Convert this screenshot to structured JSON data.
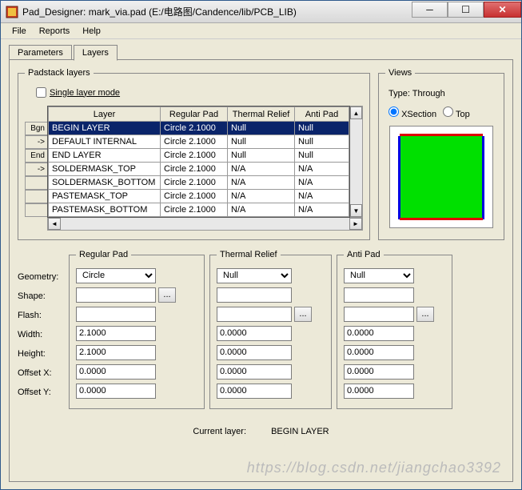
{
  "titlebar": {
    "title": "Pad_Designer: mark_via.pad (E:/电路图/Candence/lib/PCB_LIB)"
  },
  "menu": {
    "file": "File",
    "reports": "Reports",
    "help": "Help"
  },
  "tabs": {
    "parameters": "Parameters",
    "layers": "Layers"
  },
  "padstack": {
    "legend": "Padstack layers",
    "single_layer": "Single layer mode",
    "headers": {
      "layer": "Layer",
      "regular": "Regular Pad",
      "thermal": "Thermal Relief",
      "anti": "Anti Pad"
    },
    "rowlabels": [
      "Bgn",
      "->",
      "End",
      "->",
      "",
      "",
      ""
    ],
    "rows": [
      {
        "layer": "BEGIN LAYER",
        "regular": "Circle 2.1000",
        "thermal": "Null",
        "anti": "Null"
      },
      {
        "layer": "DEFAULT INTERNAL",
        "regular": "Circle 2.1000",
        "thermal": "Null",
        "anti": "Null"
      },
      {
        "layer": "END LAYER",
        "regular": "Circle 2.1000",
        "thermal": "Null",
        "anti": "Null"
      },
      {
        "layer": "SOLDERMASK_TOP",
        "regular": "Circle 2.1000",
        "thermal": "N/A",
        "anti": "N/A"
      },
      {
        "layer": "SOLDERMASK_BOTTOM",
        "regular": "Circle 2.1000",
        "thermal": "N/A",
        "anti": "N/A"
      },
      {
        "layer": "PASTEMASK_TOP",
        "regular": "Circle 2.1000",
        "thermal": "N/A",
        "anti": "N/A"
      },
      {
        "layer": "PASTEMASK_BOTTOM",
        "regular": "Circle 2.1000",
        "thermal": "N/A",
        "anti": "N/A"
      }
    ]
  },
  "views": {
    "legend": "Views",
    "type_label": "Type:",
    "type_value": "Through",
    "xsection": "XSection",
    "top": "Top"
  },
  "labels": {
    "geometry": "Geometry:",
    "shape": "Shape:",
    "flash": "Flash:",
    "width": "Width:",
    "height": "Height:",
    "offsetx": "Offset X:",
    "offsety": "Offset Y:"
  },
  "regular": {
    "legend": "Regular Pad",
    "geometry": "Circle",
    "shape": "",
    "flash": "",
    "width": "2.1000",
    "height": "2.1000",
    "ox": "0.0000",
    "oy": "0.0000"
  },
  "thermal": {
    "legend": "Thermal Relief",
    "geometry": "Null",
    "shape": "",
    "flash": "",
    "width": "0.0000",
    "height": "0.0000",
    "ox": "0.0000",
    "oy": "0.0000"
  },
  "anti": {
    "legend": "Anti Pad",
    "geometry": "Null",
    "shape": "",
    "flash": "",
    "width": "0.0000",
    "height": "0.0000",
    "ox": "0.0000",
    "oy": "0.0000"
  },
  "current": {
    "label": "Current layer:",
    "value": "BEGIN LAYER"
  },
  "browse": "...",
  "watermark": "https://blog.csdn.net/jiangchao3392"
}
